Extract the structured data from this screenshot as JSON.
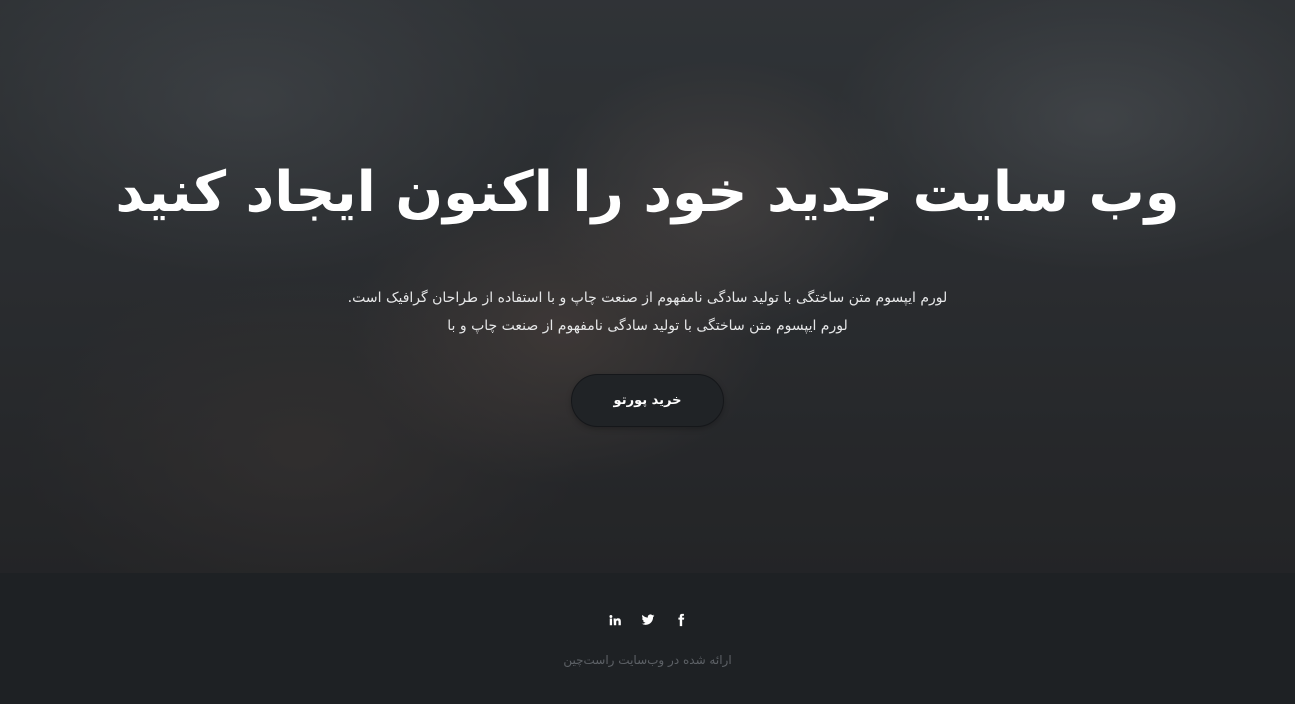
{
  "hero": {
    "title": "وب سایت جدید خود را اکنون ایجاد کنید",
    "description_line_1": "لورم ایپسوم متن ساختگی با تولید سادگی نامفهوم از صنعت چاپ و با استفاده از طراحان گرافیک است.",
    "description_line_2": "لورم ایپسوم متن ساختگی با تولید سادگی نامفهوم از صنعت چاپ و با",
    "cta_label": "خرید پورتو"
  },
  "footer": {
    "social": [
      {
        "icon": "linkedin-icon"
      },
      {
        "icon": "twitter-icon"
      },
      {
        "icon": "facebook-icon"
      }
    ],
    "credit": "ارائه شده در وب‌سایت راست‌چین"
  },
  "colors": {
    "footer_bg": "#1e2124",
    "button_bg": "#202326",
    "credit_text": "#5d6166"
  }
}
